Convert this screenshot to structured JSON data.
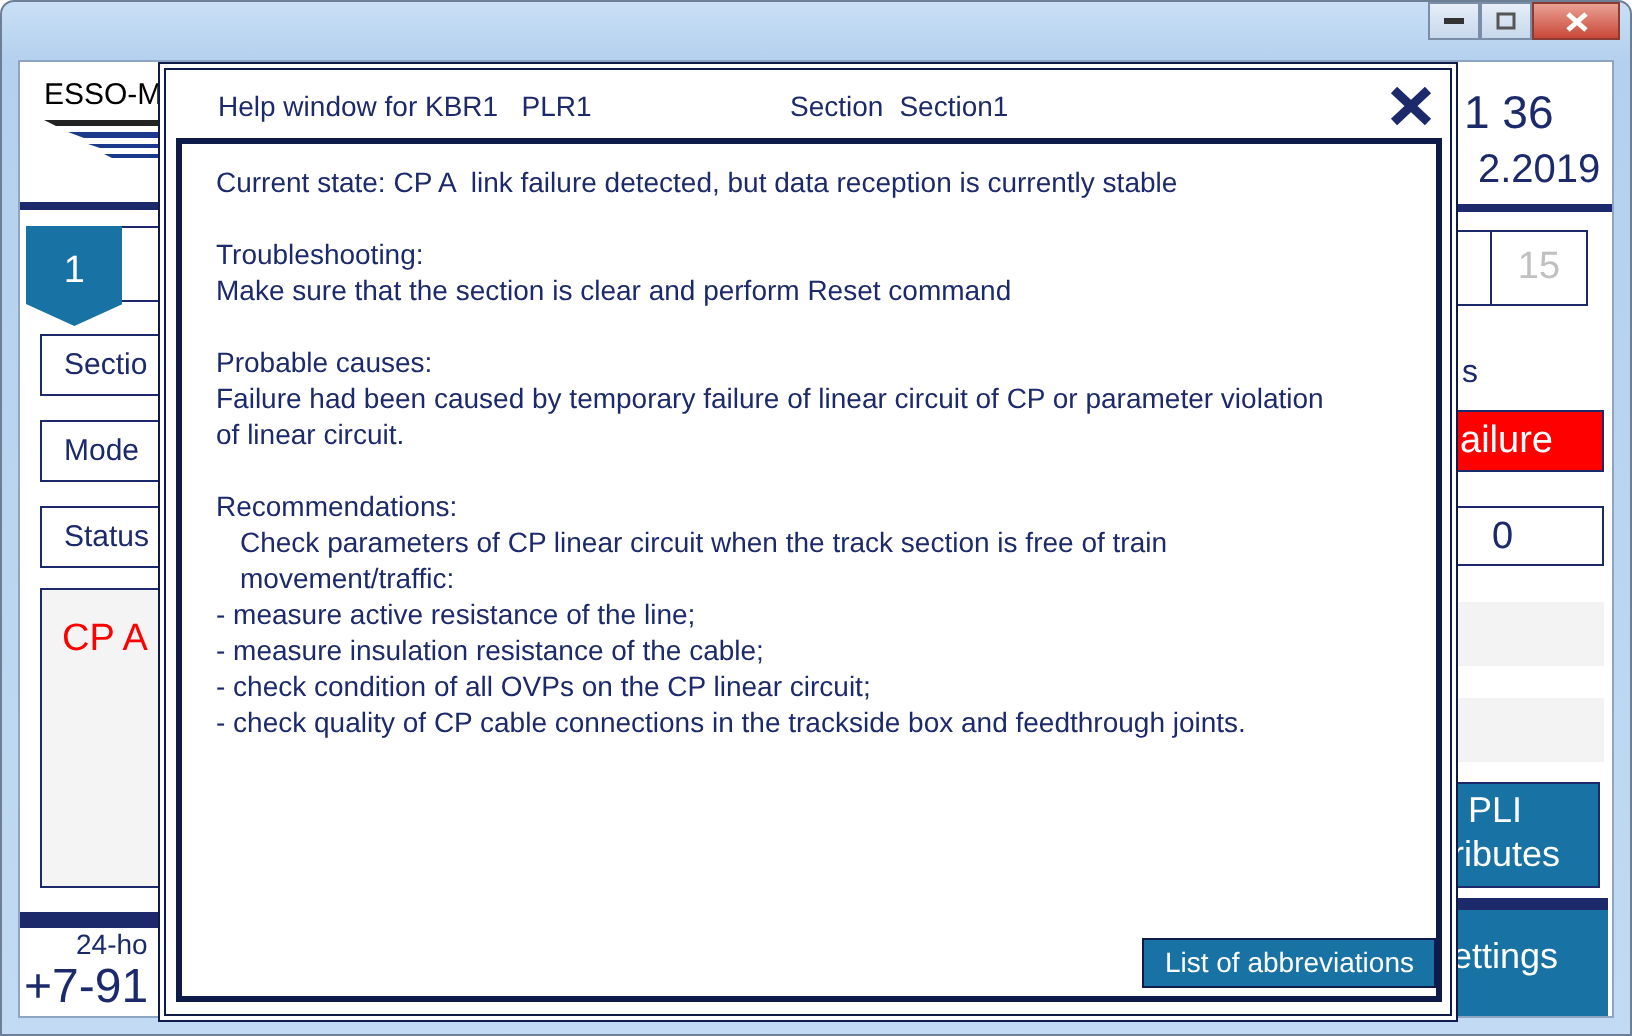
{
  "app": {
    "logo_text": "ESSO-M",
    "left_tab": {
      "label": "1",
      "selected": true
    },
    "fields": [
      {
        "label": "Sectio"
      },
      {
        "label": "Mode"
      },
      {
        "label": "Status"
      }
    ],
    "message": "CP A",
    "hotline_label": "24-ho",
    "hotline_number": "+7-91",
    "time": "1 36",
    "date": "2.2019",
    "right_tab": {
      "label": "15",
      "disabled": true
    },
    "status_label": "s",
    "status_value": "ailure",
    "counter": "0",
    "attributes_button": [
      "PLI",
      "ributes"
    ],
    "settings_button": "ettings"
  },
  "dialog": {
    "title": "Help window for KBR1   PLR1",
    "section_label": "Section",
    "section_value": "Section1",
    "current_state": "Current state: CP A  link failure detected, but data reception is currently stable",
    "blocks": [
      {
        "heading": "Troubleshooting:",
        "text": "Make sure that the section is clear and perform Reset command"
      },
      {
        "heading": "Probable causes:",
        "text": "Failure had been caused by temporary failure of linear circuit of CP or parameter violation of linear circuit."
      },
      {
        "heading": "Recommendations:",
        "text": "Check parameters of CP linear circuit when the track section is free of train movement/traffic:",
        "items": [
          "- measure active resistance of the line;",
          "- measure insulation resistance of the cable;",
          "- check condition of all OVPs on the CP linear circuit;",
          "- check quality of CP cable connections in the trackside box and feedthrough joints."
        ]
      }
    ],
    "button": "List of abbreviations"
  }
}
